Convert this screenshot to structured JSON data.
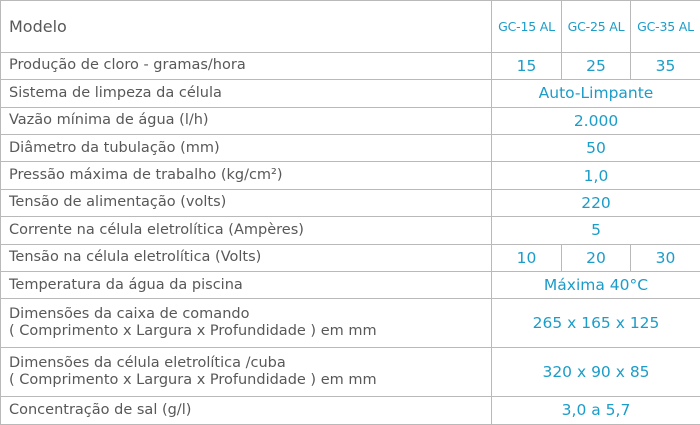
{
  "header": {
    "label": "Modelo",
    "models": [
      "GC-15 AL",
      "GC-25 AL",
      "GC-35 AL"
    ]
  },
  "rows": [
    {
      "label": "Produção de cloro - gramas/hora",
      "values": [
        "15",
        "25",
        "35"
      ]
    },
    {
      "label": "Sistema de limpeza da célula",
      "value": "Auto-Limpante"
    },
    {
      "label": "Vazão mínima de água (l/h)",
      "value": "2.000"
    },
    {
      "label": "Diâmetro da tubulação (mm)",
      "value": "50"
    },
    {
      "label": "Pressão máxima de trabalho (kg/cm²)",
      "value": "1,0"
    },
    {
      "label": "Tensão de alimentação (volts)",
      "value": "220"
    },
    {
      "label": "Corrente na célula eletrolítica (Ampères)",
      "value": "5"
    },
    {
      "label": "Tensão na célula eletrolítica (Volts)",
      "values": [
        "10",
        "20",
        "30"
      ]
    },
    {
      "label": "Temperatura da água da piscina",
      "value": "Máxima 40°C"
    },
    {
      "label_lines": [
        "Dimensões da caixa de comando",
        "( Comprimento x Largura x Profundidade ) em mm"
      ],
      "value": "265 x 165 x 125"
    },
    {
      "label_lines": [
        "Dimensões da célula eletrolítica /cuba",
        "( Comprimento x Largura x Profundidade ) em mm"
      ],
      "value": "320 x 90 x 85"
    },
    {
      "label": "Concentração de sal (g/l)",
      "value": "3,0 a 5,7"
    }
  ],
  "colors": {
    "label_text": "#585858",
    "value_text": "#1c9cc9",
    "border": "#b9b9b9"
  }
}
